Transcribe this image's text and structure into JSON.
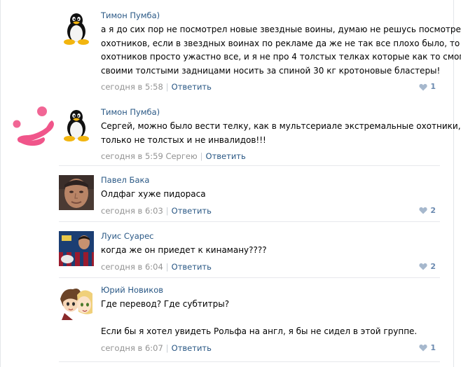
{
  "colors": {
    "author_link": "#2a5885",
    "meta_gray": "#939393",
    "like_count": "#6b8ab0",
    "divider": "#e7e8ec",
    "scribble_pink": "#f0558a"
  },
  "icons": {
    "like": "heart-icon",
    "avatar_tux": "tux-penguin-avatar"
  },
  "comments": [
    {
      "author": "Тимон Пумба)",
      "avatar": "tux-penguin",
      "lines": [
        "а я до сих пор не посмотрел новые звездные воины, думаю не решусь посмотреть и",
        "охотников, если в звездных воинах по рекламе да же не так все плохо было, то у",
        "охотников просто ужастно все, и я не про 4 толстых телках которые как то смогли",
        "своими толстыми задницами носить за спиной 30 кг кротоновые бластеры!"
      ],
      "date": "сегодня в 5:58",
      "separator": "|",
      "reply": "Ответить",
      "likes": "1"
    },
    {
      "author": "Тимон Пумба)",
      "avatar": "tux-penguin",
      "lines": [
        "Сергей, можно было вести телку, как в мультсериале экстремальные охотники,",
        "только не толстых и не инвалидов!!!"
      ],
      "date": "сегодня в 5:59",
      "addressee": "Сергею",
      "separator": "|",
      "reply": "Ответить"
    },
    {
      "author": "Павел Бака",
      "avatar": "photo-man-face",
      "lines": [
        "Олдфаг хуже пидораса"
      ],
      "date": "сегодня в 6:03",
      "separator": "|",
      "reply": "Ответить",
      "likes": "2"
    },
    {
      "author": "Луис Суарес",
      "avatar": "photo-footballer",
      "lines": [
        "когда же он приедет к кинаману????"
      ],
      "date": "сегодня в 6:04",
      "separator": "|",
      "reply": "Ответить",
      "likes": "2"
    },
    {
      "author": "Юрий Новиков",
      "avatar": "anime-characters",
      "lines": [
        "Где перевод? Где субтитры?",
        "",
        "Если бы я хотел увидеть Рольфа на англ, я бы не сидел в этой группе."
      ],
      "date": "сегодня в 6:07",
      "separator": "|",
      "reply": "Ответить",
      "likes": "1"
    }
  ]
}
